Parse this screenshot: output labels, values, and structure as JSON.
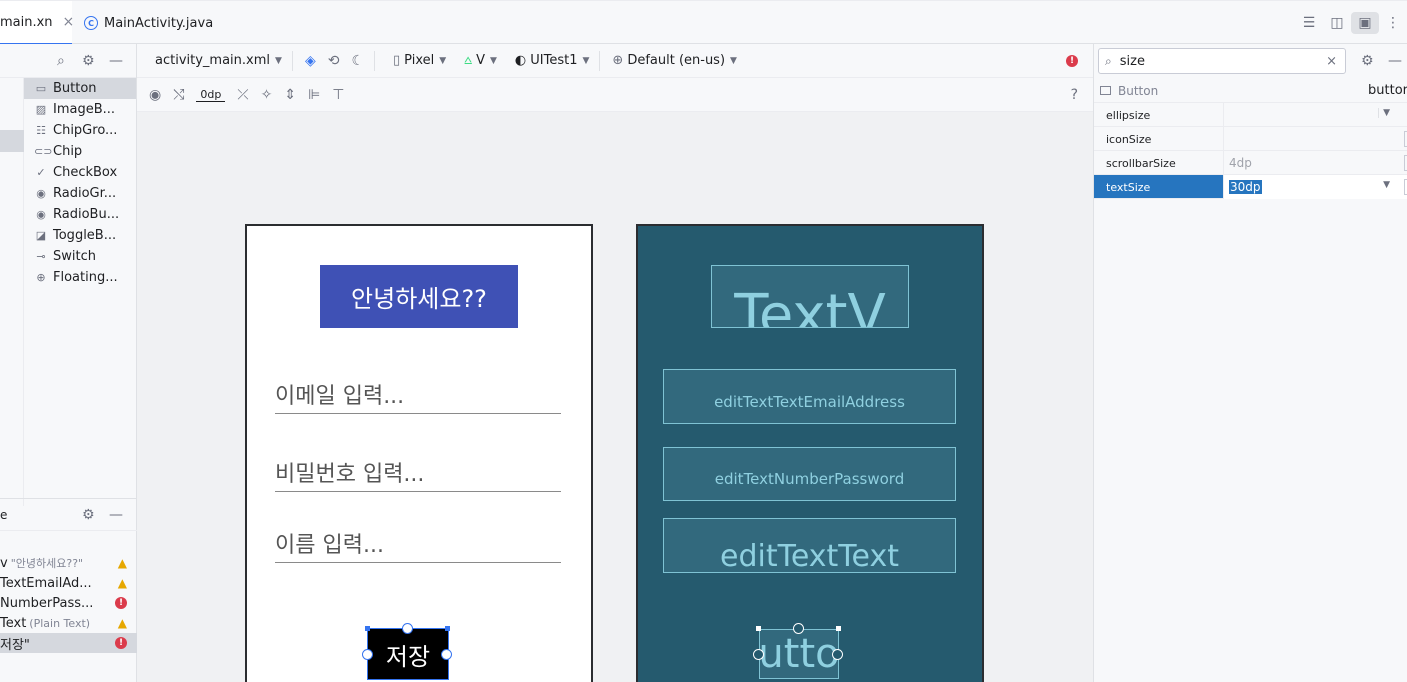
{
  "tabs": {
    "active_label": "main.xn",
    "second_label": "MainActivity.java",
    "java_icon": "C",
    "close": "×"
  },
  "palette": {
    "items": [
      {
        "label": "Button",
        "icon": "button-icon"
      },
      {
        "label": "ImageB...",
        "icon": "image-button-icon"
      },
      {
        "label": "ChipGro...",
        "icon": "chip-group-icon"
      },
      {
        "label": "Chip",
        "icon": "chip-icon"
      },
      {
        "label": "CheckBox",
        "icon": "checkbox-icon"
      },
      {
        "label": "RadioGr...",
        "icon": "radio-group-icon"
      },
      {
        "label": "RadioBu...",
        "icon": "radio-button-icon"
      },
      {
        "label": "ToggleB...",
        "icon": "toggle-button-icon"
      },
      {
        "label": "Switch",
        "icon": "switch-icon"
      },
      {
        "label": "Floating...",
        "icon": "fab-icon"
      }
    ]
  },
  "tree": {
    "title": "e",
    "rows": [
      {
        "label": "v",
        "sub": "\"안녕하세요??\"",
        "status": "warning"
      },
      {
        "label": "TextEmailAd...",
        "sub": "",
        "status": "warning"
      },
      {
        "label": "NumberPass...",
        "sub": "",
        "status": "error"
      },
      {
        "label": "Text",
        "sub": "(Plain Text)",
        "status": "warning"
      },
      {
        "label": "저장\"",
        "sub": "",
        "status": "error"
      }
    ]
  },
  "toolbar": {
    "file": "activity_main.xml",
    "device": "Pixel",
    "api": "V",
    "theme": "UITest1",
    "locale": "Default (en-us)",
    "margin": "0dp",
    "help": "?"
  },
  "phone": {
    "greeting": "안녕하세요??",
    "email_hint": "이메일 입력...",
    "password_hint": "비밀번호 입력...",
    "name_hint": "이름 입력...",
    "save_button": "저장"
  },
  "blueprint": {
    "textview": "TextV",
    "email": "editTextTextEmailAddress",
    "password": "editTextNumberPassword",
    "text": "editTextText",
    "button": "utto"
  },
  "attributes": {
    "search_value": "size",
    "component": "Button",
    "component_id": "buttor",
    "rows": [
      {
        "name": "ellipsize",
        "value": ""
      },
      {
        "name": "iconSize",
        "value": ""
      },
      {
        "name": "scrollbarSize",
        "value": "4dp"
      },
      {
        "name": "textSize",
        "value": "30dp"
      }
    ]
  },
  "colors": {
    "accent": "#3574f0",
    "greeting_bg": "#3f51b5",
    "blueprint_bg": "#255a6e",
    "selected_row": "#2675bf"
  }
}
